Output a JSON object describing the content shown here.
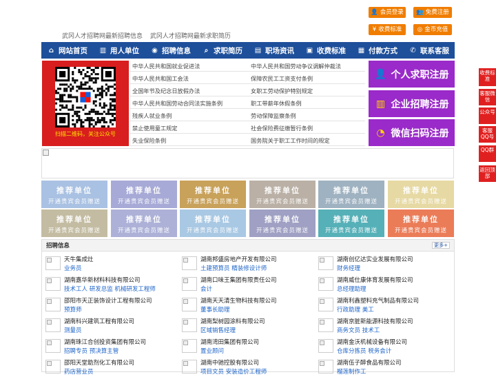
{
  "top": {
    "links": [
      "武冈人才招聘网最新招聘信息",
      "武冈人才招聘网最新求职简历"
    ],
    "buttons": {
      "member_login": "会员登录",
      "free_register": "免费注册",
      "fee_standard": "收费标准",
      "gold_recharge": "金币充值"
    },
    "accent": "#f07d00"
  },
  "nav": {
    "items": [
      {
        "label": "网站首页",
        "icon": "home-icon",
        "glyph": "⌂"
      },
      {
        "label": "用人单位",
        "icon": "building-icon",
        "glyph": "▥"
      },
      {
        "label": "招聘信息",
        "icon": "broadcast-icon",
        "glyph": "◉"
      },
      {
        "label": "求职简历",
        "icon": "search-icon",
        "glyph": "⌕"
      },
      {
        "label": "职场资讯",
        "icon": "news-icon",
        "glyph": "▤"
      },
      {
        "label": "收费标准",
        "icon": "wallet-icon",
        "glyph": "▣"
      },
      {
        "label": "付款方式",
        "icon": "payment-icon",
        "glyph": "▦"
      },
      {
        "label": "联系客服",
        "icon": "phone-icon",
        "glyph": "✆"
      }
    ],
    "color": "#1e4f9a"
  },
  "qr": {
    "caption": "扫描二维码，关注公众号"
  },
  "laws": [
    "中华人民共和国就业促进法",
    "中华人民共和国劳动争议调解仲裁法",
    "中华人民共和国工会法",
    "保障农民工工资支付条例",
    "全国年节及纪念日放假办法",
    "女职工劳动保护特别规定",
    "中华人民共和国劳动合同法实施条例",
    "职工带薪年休假条例",
    "残疾人就业条例",
    "劳动保障监察条例",
    "禁止使用童工规定",
    "社会保险费征缴暂行条例",
    "失业保险条例",
    "国务院关于职工工作时间的规定"
  ],
  "register": {
    "personal": "个人求职注册",
    "company": "企业招聘注册",
    "wechat": "微信扫码注册",
    "color": "#9a2ac9"
  },
  "promo": {
    "title": "推荐单位",
    "subtitle": "开通贵宾会员赠送",
    "colors": [
      "#a9c1e2",
      "#a7aad6",
      "#c8a15a",
      "#bab0a5",
      "#9fb2c1",
      "#e6d9a3",
      "#c3bca2",
      "#adb1d7",
      "#a9c8e3",
      "#9fa0c3",
      "#56b0b8",
      "#eb7c58",
      "#9db3bd"
    ]
  },
  "jobs": {
    "title": "招聘信息",
    "more": "更多+",
    "rows": [
      [
        {
          "company": "天牛集成灶",
          "positions": "业务员"
        },
        {
          "company": "湖南邦盛房地产开发有限公司",
          "positions": "土建预算员 精装修设计师"
        },
        {
          "company": "湖南创亿达实业发展有限公司",
          "positions": "财务经理"
        }
      ],
      [
        {
          "company": "湖南嘉华新材料科技有限公司",
          "positions": "技术工人 研发总监 机械研发工程师"
        },
        {
          "company": "湖南口味王集团有限责任公司",
          "positions": "会计"
        },
        {
          "company": "湖南威仕康体育发展有限公司",
          "positions": "总经理助理"
        }
      ],
      [
        {
          "company": "邵阳市天正装饰设计工程有限公司",
          "positions": "预算师"
        },
        {
          "company": "湖南天天清生物科技有限公司",
          "positions": "董事长助理"
        },
        {
          "company": "湖南利鑫塑料充气制品有限公司",
          "positions": "行政助理 美工"
        }
      ],
      [
        {
          "company": "湖南科兴建筑工程有限公司",
          "positions": "测量员"
        },
        {
          "company": "湖南梨树园涂料有限公司",
          "positions": "区域销售经理"
        },
        {
          "company": "湖南京脏新能源科技有限公司",
          "positions": "商务文员 技术工"
        }
      ],
      [
        {
          "company": "湖南珠江合创投资集团有限公司",
          "positions": "招聘专员 预决算主管"
        },
        {
          "company": "湖南湾田集团有限公司",
          "positions": "置业顾问"
        },
        {
          "company": "湖南金沃机械设备有限公司",
          "positions": "仓库分拣员 税务会计"
        }
      ],
      [
        {
          "company": "邵阳天堂助剂化工有限公司",
          "positions": "药店营业员"
        },
        {
          "company": "湖南中驰控股有限公司",
          "positions": "项目文员 安装造价工程师"
        },
        {
          "company": "湖南伍子醉食品有限公司",
          "positions": "榴莲制作工"
        }
      ]
    ]
  },
  "side": [
    {
      "label": "收费标准"
    },
    {
      "label": "客服微信"
    },
    {
      "label": "公众号"
    },
    {
      "label": "客服QQ号"
    },
    {
      "label": "QQ群"
    },
    {
      "label": "返回顶部"
    }
  ]
}
